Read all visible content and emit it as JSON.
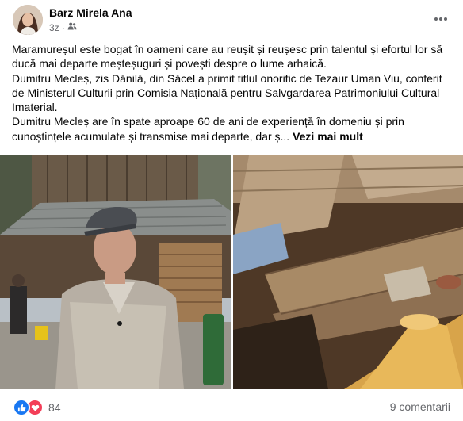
{
  "post": {
    "author": "Barz Mirela Ana",
    "time": "3z",
    "paragraphs": [
      "Maramureșul este bogat în oameni care au reușit și reușesc prin talentul și efortul lor să ducă mai departe meșteșuguri și povești despre o lume arhaică.",
      "Dumitru Mecleș, zis Dănilă, din Săcel a primit titlul onorific de Tezaur Uman Viu, conferit de Ministerul Culturii prin Comisia Națională pentru Salvgardarea Patrimoniului Cultural Imaterial.",
      "Dumitru Mecleș are în spate aproape 60 de ani de experiență în domeniu și prin cunoștințele acumulate și transmise mai departe, dar ș..."
    ],
    "see_more": "Vezi mai mult"
  },
  "icons": {
    "audience": "friends-icon",
    "more": "more-options-icon",
    "like": "like-reaction-icon",
    "love": "love-reaction-icon"
  },
  "footer": {
    "reaction_count": "84",
    "comments": "9 comentarii"
  },
  "colors": {
    "like": "#1877f2",
    "love": "#f33e58",
    "secondary_text": "#65676b"
  }
}
